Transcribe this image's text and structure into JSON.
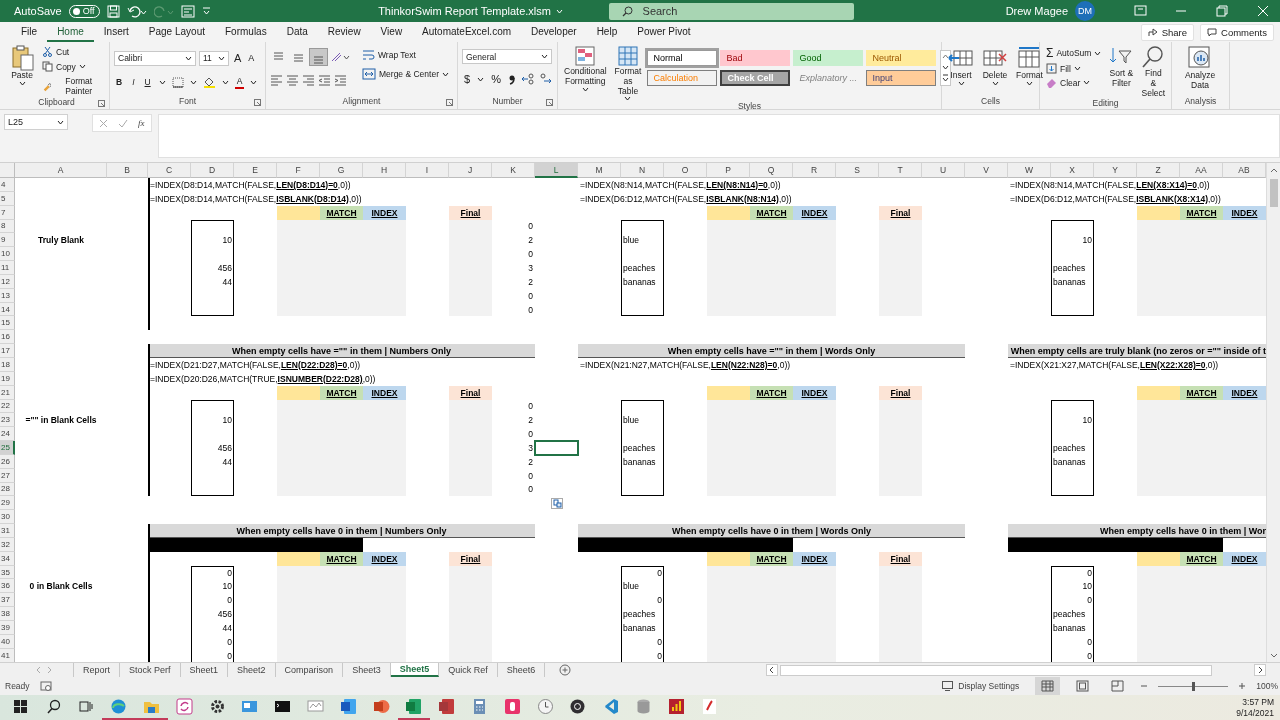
{
  "title_bar": {
    "autosave_label": "AutoSave",
    "autosave": {
      "on": false,
      "label": "Off"
    },
    "document_title": "ThinkorSwim Report Template.xlsm",
    "search_placeholder": "Search",
    "user_name": "Drew Magee",
    "user_initials": "DM"
  },
  "menu_tabs": [
    {
      "label": "File",
      "selected": false
    },
    {
      "label": "Home",
      "selected": true
    },
    {
      "label": "Insert",
      "selected": false
    },
    {
      "label": "Page Layout",
      "selected": false
    },
    {
      "label": "Formulas",
      "selected": false
    },
    {
      "label": "Data",
      "selected": false
    },
    {
      "label": "Review",
      "selected": false
    },
    {
      "label": "View",
      "selected": false
    },
    {
      "label": "AutomateExcel.com",
      "selected": false
    },
    {
      "label": "Developer",
      "selected": false
    },
    {
      "label": "Help",
      "selected": false
    },
    {
      "label": "Power Pivot",
      "selected": false
    }
  ],
  "share": "Share",
  "comments": "Comments",
  "ribbon": {
    "clipboard": {
      "label": "Clipboard",
      "paste": "Paste",
      "cut": "Cut",
      "copy": "Copy",
      "format_painter": "Format Painter"
    },
    "font": {
      "label": "Font",
      "font_name": "Calibri",
      "font_size": "11",
      "grow": "A",
      "shrink": "A",
      "bold": "B",
      "italic": "I",
      "underline": "U",
      "font_color": "A"
    },
    "alignment": {
      "label": "Alignment",
      "wrap_text": "Wrap Text",
      "merge_center": "Merge & Center",
      "vertical": [
        {
          "kind": "top",
          "selected": false
        },
        {
          "kind": "middle",
          "selected": false
        },
        {
          "kind": "bottom",
          "selected": true
        }
      ]
    },
    "number": {
      "label": "Number",
      "format": "General",
      "currency": "$",
      "percent": "%"
    },
    "styles": {
      "label": "Styles",
      "conditional_formatting": "Conditional Formatting",
      "format_as_table": "Format as Table",
      "cell_styles": [
        {
          "label": "Normal",
          "kind": "normal",
          "selected": true
        },
        {
          "label": "Bad",
          "kind": "bad",
          "selected": false
        },
        {
          "label": "Good",
          "kind": "good",
          "selected": false
        },
        {
          "label": "Neutral",
          "kind": "neutral",
          "selected": false
        },
        {
          "label": "Calculation",
          "kind": "calculation",
          "selected": false
        },
        {
          "label": "Check Cell",
          "kind": "check",
          "selected": false
        },
        {
          "label": "Explanatory ...",
          "kind": "explanatory",
          "selected": false
        },
        {
          "label": "Input",
          "kind": "input",
          "selected": false
        }
      ]
    },
    "cells": {
      "label": "Cells",
      "insert": "Insert",
      "delete": "Delete",
      "format": "Format"
    },
    "editing": {
      "label": "Editing",
      "autosum_symbol": "Σ",
      "autosum": "AutoSum",
      "fill": "Fill",
      "clear": "Clear",
      "sort_filter": "Sort & Filter",
      "find_select": "Find & Select"
    },
    "analysis": {
      "label": "Analysis",
      "analyze_data": "Analyze Data"
    }
  },
  "formula_bar": {
    "name_box": "L25",
    "function_label": "fx"
  },
  "sheet": {
    "columns": [
      {
        "label": "A",
        "selected": false
      },
      {
        "label": "B",
        "selected": false
      },
      {
        "label": "C",
        "selected": false
      },
      {
        "label": "D",
        "selected": false
      },
      {
        "label": "E",
        "selected": false
      },
      {
        "label": "F",
        "selected": false
      },
      {
        "label": "G",
        "selected": false
      },
      {
        "label": "H",
        "selected": false
      },
      {
        "label": "I",
        "selected": false
      },
      {
        "label": "J",
        "selected": false
      },
      {
        "label": "K",
        "selected": false
      },
      {
        "label": "L",
        "selected": true
      },
      {
        "label": "M",
        "selected": false
      },
      {
        "label": "N",
        "selected": false
      },
      {
        "label": "O",
        "selected": false
      },
      {
        "label": "P",
        "selected": false
      },
      {
        "label": "Q",
        "selected": false
      },
      {
        "label": "R",
        "selected": false
      },
      {
        "label": "S",
        "selected": false
      },
      {
        "label": "T",
        "selected": false
      },
      {
        "label": "U",
        "selected": false
      },
      {
        "label": "V",
        "selected": false
      },
      {
        "label": "W",
        "selected": false
      },
      {
        "label": "X",
        "selected": false
      },
      {
        "label": "Y",
        "selected": false
      },
      {
        "label": "Z",
        "selected": false
      },
      {
        "label": "AA",
        "selected": false
      },
      {
        "label": "AB",
        "selected": false
      }
    ],
    "rows": [
      {
        "label": "4",
        "selected": false
      },
      {
        "label": "5",
        "selected": false
      },
      {
        "label": "7",
        "selected": false
      },
      {
        "label": "8",
        "selected": false
      },
      {
        "label": "9",
        "selected": false
      },
      {
        "label": "10",
        "selected": false
      },
      {
        "label": "11",
        "selected": false
      },
      {
        "label": "12",
        "selected": false
      },
      {
        "label": "13",
        "selected": false
      },
      {
        "label": "14",
        "selected": false
      },
      {
        "label": "15",
        "selected": false
      },
      {
        "label": "16",
        "selected": false
      },
      {
        "label": "17",
        "selected": false
      },
      {
        "label": "18",
        "selected": false
      },
      {
        "label": "19",
        "selected": false
      },
      {
        "label": "21",
        "selected": false
      },
      {
        "label": "22",
        "selected": false
      },
      {
        "label": "23",
        "selected": false
      },
      {
        "label": "24",
        "selected": false
      },
      {
        "label": "25",
        "selected": true
      },
      {
        "label": "26",
        "selected": false
      },
      {
        "label": "27",
        "selected": false
      },
      {
        "label": "28",
        "selected": false
      },
      {
        "label": "29",
        "selected": false
      },
      {
        "label": "30",
        "selected": false
      },
      {
        "label": "31",
        "selected": false
      },
      {
        "label": "32",
        "selected": false
      },
      {
        "label": "34",
        "selected": false
      },
      {
        "label": "35",
        "selected": false
      },
      {
        "label": "36",
        "selected": false
      },
      {
        "label": "37",
        "selected": false
      },
      {
        "label": "38",
        "selected": false
      },
      {
        "label": "39",
        "selected": false
      },
      {
        "label": "40",
        "selected": false
      },
      {
        "label": "41",
        "selected": false
      }
    ],
    "sections": [
      {
        "label": "Truly Blank",
        "panels": [
          {
            "formulas": [
              "=INDEX(D8:D14,MATCH(FALSE,**LEN(D8:D14)=0**,0))",
              "=INDEX(D8:D14,MATCH(FALSE,**ISBLANK(D8:D14)**,0))"
            ],
            "match": "MATCH",
            "index": "INDEX",
            "final": "Final",
            "values": [
              {
                "kind": "blank"
              },
              {
                "kind": "number",
                "value": "10"
              },
              {
                "kind": "blank"
              },
              {
                "kind": "number",
                "value": "456"
              },
              {
                "kind": "number",
                "value": "44"
              },
              {
                "kind": "blank"
              },
              {
                "kind": "blank"
              }
            ],
            "counts": [
              "0",
              "2",
              "0",
              "3",
              "2",
              "0",
              "0"
            ]
          },
          {
            "formulas": [
              "=INDEX(N8:N14,MATCH(FALSE,**LEN(N8:N14)=0**,0))",
              "=INDEX(D6:D12,MATCH(FALSE,**ISBLANK(N8:N14)**,0))"
            ],
            "match": "MATCH",
            "index": "INDEX",
            "final": "Final",
            "values": [
              {
                "kind": "blank"
              },
              {
                "kind": "text",
                "value": "blue"
              },
              {
                "kind": "blank"
              },
              {
                "kind": "text",
                "value": "peaches"
              },
              {
                "kind": "text",
                "value": "bananas"
              },
              {
                "kind": "blank"
              },
              {
                "kind": "blank"
              }
            ]
          },
          {
            "formulas": [
              "=INDEX(N8:N14,MATCH(FALSE,**LEN(X8:X14)=0**,0))",
              "=INDEX(D6:D12,MATCH(FALSE,**ISBLANK(X8:X14)**,0))"
            ],
            "match": "MATCH",
            "index": "INDEX",
            "values": [
              {
                "kind": "blank"
              },
              {
                "kind": "number",
                "value": "10"
              },
              {
                "kind": "blank"
              },
              {
                "kind": "text",
                "value": "peaches"
              },
              {
                "kind": "text",
                "value": "bananas"
              },
              {
                "kind": "blank"
              },
              {
                "kind": "blank"
              }
            ]
          }
        ]
      },
      {
        "label": "=\"\" in Blank Cells",
        "panels": [
          {
            "title": "When empty cells have =\"\" in them | Numbers Only",
            "formulas": [
              "=INDEX(D21:D27,MATCH(FALSE,**LEN(D22:D28)=0**,0))",
              "=INDEX(D20:D26,MATCH(TRUE,**ISNUMBER(D22:D28)**,0))"
            ],
            "match": "MATCH",
            "index": "INDEX",
            "final": "Final",
            "values": [
              {
                "kind": "blank"
              },
              {
                "kind": "number",
                "value": "10"
              },
              {
                "kind": "blank"
              },
              {
                "kind": "number",
                "value": "456"
              },
              {
                "kind": "number",
                "value": "44"
              },
              {
                "kind": "blank"
              },
              {
                "kind": "blank"
              }
            ],
            "counts": [
              "0",
              "2",
              "0",
              "3",
              "2",
              "0",
              "0"
            ]
          },
          {
            "title": "When empty cells have =\"\" in them | Words Only",
            "formulas": [
              "=INDEX(N21:N27,MATCH(FALSE,**LEN(N22:N28)=0**,0))"
            ],
            "match": "MATCH",
            "index": "INDEX",
            "final": "Final",
            "values": [
              {
                "kind": "blank"
              },
              {
                "kind": "text",
                "value": "blue"
              },
              {
                "kind": "blank"
              },
              {
                "kind": "text",
                "value": "peaches"
              },
              {
                "kind": "text",
                "value": "bananas"
              },
              {
                "kind": "blank"
              },
              {
                "kind": "blank"
              }
            ]
          },
          {
            "title": "When empty cells are truly blank (no zeros or =\"\" inside of t",
            "formulas": [
              "=INDEX(X21:X27,MATCH(FALSE,**LEN(X22:X28)=0**,0))"
            ],
            "match": "MATCH",
            "index": "INDEX",
            "values": [
              {
                "kind": "blank"
              },
              {
                "kind": "number",
                "value": "10"
              },
              {
                "kind": "blank"
              },
              {
                "kind": "text",
                "value": "peaches"
              },
              {
                "kind": "text",
                "value": "bananas"
              },
              {
                "kind": "blank"
              },
              {
                "kind": "blank"
              }
            ]
          }
        ]
      },
      {
        "label": "0 in Blank Cells",
        "panels": [
          {
            "title": "When empty cells have 0 in them | Numbers Only",
            "black_bar": true,
            "match": "MATCH",
            "index": "INDEX",
            "final": "Final",
            "values": [
              {
                "kind": "number",
                "value": "0"
              },
              {
                "kind": "number",
                "value": "10"
              },
              {
                "kind": "number",
                "value": "0"
              },
              {
                "kind": "number",
                "value": "456"
              },
              {
                "kind": "number",
                "value": "44"
              },
              {
                "kind": "number",
                "value": "0"
              },
              {
                "kind": "number",
                "value": "0"
              }
            ]
          },
          {
            "title": "When empty cells have 0 in them | Words Only",
            "black_bar": true,
            "match": "MATCH",
            "index": "INDEX",
            "final": "Final",
            "values": [
              {
                "kind": "number",
                "value": "0"
              },
              {
                "kind": "text",
                "value": "blue"
              },
              {
                "kind": "number",
                "value": "0"
              },
              {
                "kind": "text",
                "value": "peaches"
              },
              {
                "kind": "text",
                "value": "bananas"
              },
              {
                "kind": "number",
                "value": "0"
              },
              {
                "kind": "number",
                "value": "0"
              }
            ]
          },
          {
            "title": "When empty cells have 0 in them | Wor",
            "black_bar": true,
            "match": "MATCH",
            "index": "INDEX",
            "values": [
              {
                "kind": "number",
                "value": "0"
              },
              {
                "kind": "number",
                "value": "10"
              },
              {
                "kind": "number",
                "value": "0"
              },
              {
                "kind": "text",
                "value": "peaches"
              },
              {
                "kind": "text",
                "value": "bananas"
              },
              {
                "kind": "number",
                "value": "0"
              },
              {
                "kind": "number",
                "value": "0"
              }
            ]
          }
        ]
      }
    ]
  },
  "sheet_tabs": [
    {
      "label": "Report",
      "selected": false
    },
    {
      "label": "Stock Perf",
      "selected": false
    },
    {
      "label": "Sheet1",
      "selected": false
    },
    {
      "label": "Sheet2",
      "selected": false
    },
    {
      "label": "Comparison",
      "selected": false
    },
    {
      "label": "Sheet3",
      "selected": false
    },
    {
      "label": "Sheet5",
      "selected": true
    },
    {
      "label": "Quick Ref",
      "selected": false
    },
    {
      "label": "Sheet6",
      "selected": false
    }
  ],
  "status_bar": {
    "mode": "Ready",
    "display_settings": "Display Settings",
    "views": [
      {
        "kind": "normal",
        "selected": true
      },
      {
        "kind": "page_layout",
        "selected": false
      },
      {
        "kind": "page_break",
        "selected": false
      }
    ],
    "zoom": {
      "level": 0.5
    },
    "zoom_label": "100%"
  },
  "taskbar": {
    "apps": [
      {
        "kind": "start",
        "running": false
      },
      {
        "kind": "search",
        "running": false
      },
      {
        "kind": "taskview",
        "running": false
      },
      {
        "kind": "browser",
        "running": true
      },
      {
        "kind": "folder",
        "running": true
      },
      {
        "kind": "sync",
        "running": false
      },
      {
        "kind": "settings",
        "running": false
      },
      {
        "kind": "remote",
        "running": false
      },
      {
        "kind": "terminal",
        "running": false
      },
      {
        "kind": "monitor",
        "running": false
      },
      {
        "kind": "blue",
        "running": false
      },
      {
        "kind": "orange",
        "running": false
      },
      {
        "kind": "green",
        "running": true
      },
      {
        "kind": "red",
        "running": false
      },
      {
        "kind": "calculator",
        "running": false
      },
      {
        "kind": "pink",
        "running": false
      },
      {
        "kind": "clock",
        "running": false
      },
      {
        "kind": "record",
        "running": false
      },
      {
        "kind": "code",
        "running": false
      },
      {
        "kind": "database",
        "running": false
      },
      {
        "kind": "chart",
        "running": false
      },
      {
        "kind": "pdf",
        "running": false
      }
    ],
    "time": "3:57 PM",
    "date": "9/14/2021"
  }
}
